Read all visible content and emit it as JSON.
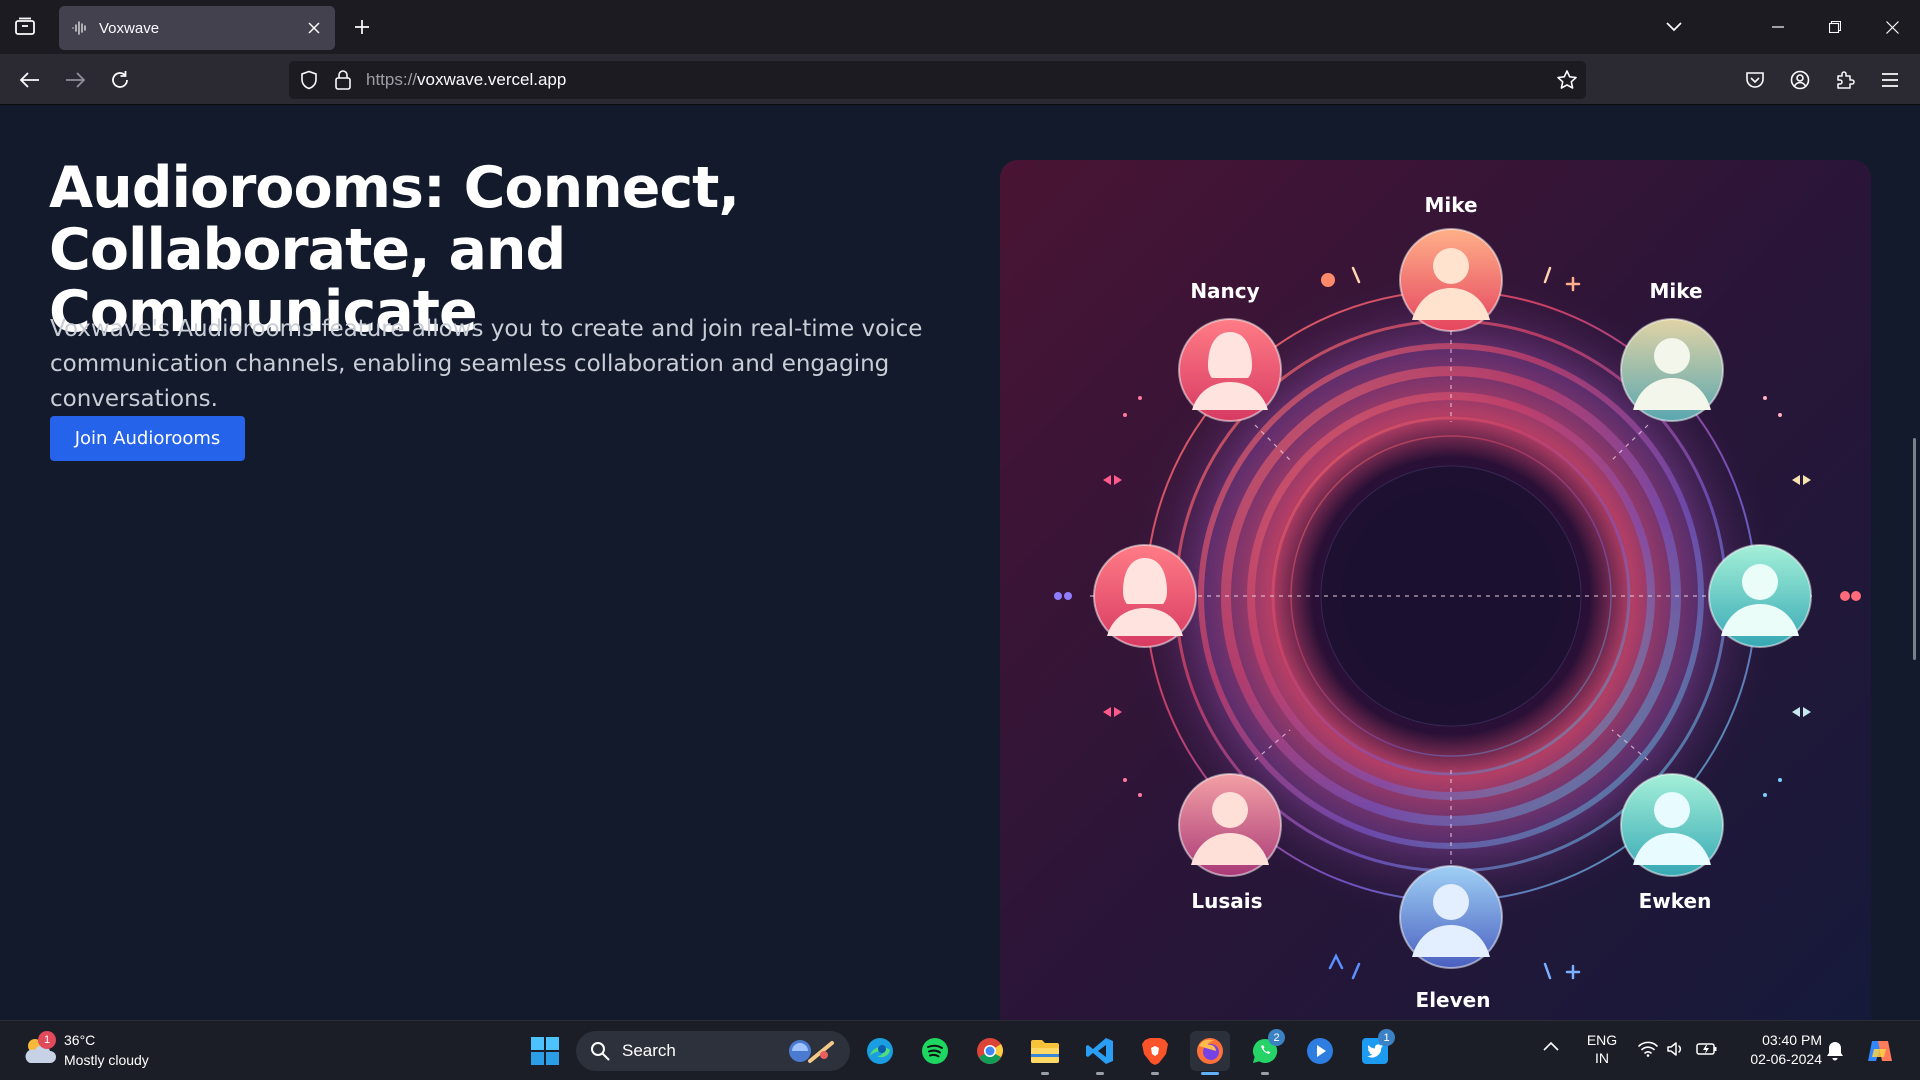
{
  "browser": {
    "tab": {
      "title": "Voxwave"
    },
    "url": {
      "protocol": "https://",
      "host": "voxwave.vercel.app"
    }
  },
  "page": {
    "hero": {
      "title_line1": "Audiorooms: Connect,",
      "title_line2": "Collaborate, and Communicate",
      "description": "Voxwave's Audiorooms feature allows you to create and join real-time voice communication channels, enabling seamless collaboration and engaging conversations.",
      "cta_label": "Join Audiorooms"
    },
    "illustration": {
      "participants": [
        "Mike",
        "Nancy",
        "Mike",
        "Lusais",
        "Ewken",
        "Eleven"
      ]
    }
  },
  "taskbar": {
    "weather": {
      "temp": "36°C",
      "condition": "Mostly cloudy",
      "badge": "1"
    },
    "search_label": "Search",
    "apps": [
      {
        "name": "start",
        "icon": "windows-logo-icon"
      },
      {
        "name": "edge",
        "icon": "edge-icon"
      },
      {
        "name": "spotify",
        "icon": "spotify-icon"
      },
      {
        "name": "chrome",
        "icon": "chrome-icon"
      },
      {
        "name": "file-explorer",
        "icon": "folder-icon"
      },
      {
        "name": "vscode",
        "icon": "vscode-icon"
      },
      {
        "name": "brave",
        "icon": "brave-icon"
      },
      {
        "name": "firefox",
        "icon": "firefox-icon"
      },
      {
        "name": "whatsapp",
        "icon": "whatsapp-icon",
        "badge": "2"
      },
      {
        "name": "media-player",
        "icon": "play-icon"
      },
      {
        "name": "twitter",
        "icon": "twitter-icon",
        "badge": "1"
      }
    ],
    "tray": {
      "language_line1": "ENG",
      "language_line2": "IN",
      "time": "03:40 PM",
      "date": "02-06-2024"
    }
  },
  "colors": {
    "page_bg": "#131a2c",
    "accent": "#2563eb",
    "chrome_dark": "#1c1b22",
    "chrome_toolbar": "#2b2a33",
    "taskbar_bg": "#1b1e26"
  }
}
